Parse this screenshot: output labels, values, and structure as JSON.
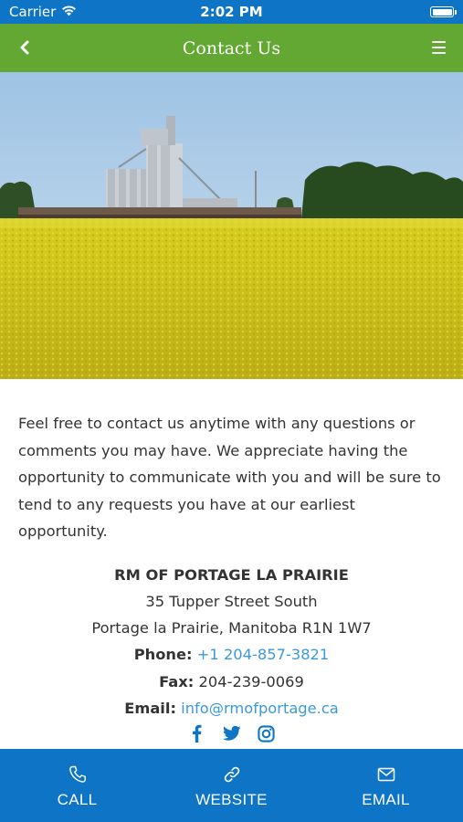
{
  "status_bar": {
    "carrier": "Carrier",
    "time": "2:02 PM",
    "wifi_icon": "wifi-icon",
    "battery_icon": "battery-icon"
  },
  "nav": {
    "title": "Contact Us",
    "back_icon": "chevron-left-icon",
    "menu_icon": "hamburger-menu-icon",
    "background": "#62a832"
  },
  "hero": {
    "image": "grain-elevator-canola-field-photo"
  },
  "intro_text": "Feel free to contact us anytime with any questions or comments you may have. We appreciate having the opportunity to communicate with you and will be sure to tend to any requests you have at our earliest opportunity.",
  "contact": {
    "org_name": "RM OF PORTAGE LA PRAIRIE",
    "street": "35 Tupper Street South",
    "city": "Portage la Prairie, Manitoba R1N 1W7",
    "phone_label": "Phone:",
    "phone": "+1 204-857-3821",
    "fax_label": "Fax:",
    "fax": "204-239-0069",
    "email_label": "Email:",
    "email": "info@rmofportage.ca",
    "link_color": "#3a9ad9"
  },
  "social": [
    {
      "icon": "facebook-icon"
    },
    {
      "icon": "twitter-icon"
    },
    {
      "icon": "instagram-icon"
    }
  ],
  "actions": [
    {
      "label": "CALL",
      "icon": "phone-icon"
    },
    {
      "label": "WEBSITE",
      "icon": "link-icon"
    },
    {
      "label": "EMAIL",
      "icon": "envelope-icon"
    }
  ],
  "colors": {
    "primary_blue": "#0d74c6",
    "nav_green": "#62a832"
  }
}
